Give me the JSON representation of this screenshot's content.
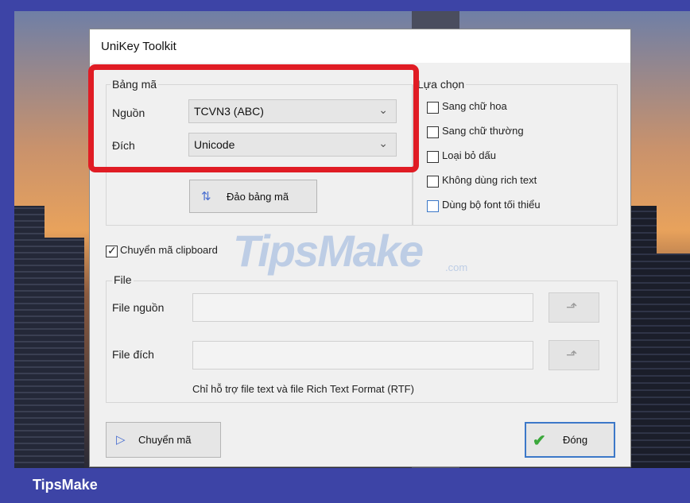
{
  "window": {
    "title": "UniKey Toolkit"
  },
  "charset": {
    "legend": "Bảng mã",
    "source_label": "Nguồn",
    "source_value": "TCVN3 (ABC)",
    "target_label": "Đích",
    "target_value": "Unicode",
    "swap_button": "Đảo bảng mã"
  },
  "options": {
    "legend": "Lựa chọn",
    "items": [
      {
        "label": "Sang chữ hoa",
        "checked": false
      },
      {
        "label": "Sang chữ thường",
        "checked": false
      },
      {
        "label": "Loại bỏ dấu",
        "checked": false
      },
      {
        "label": "Không dùng rich text",
        "checked": false
      },
      {
        "label": "Dùng bộ font tối thiểu",
        "checked": false
      }
    ]
  },
  "clipboard": {
    "label": "Chuyển mã clipboard",
    "checked": true
  },
  "file": {
    "legend": "File",
    "source_label": "File nguồn",
    "source_value": "",
    "target_label": "File đích",
    "target_value": "",
    "note": "Chỉ hỗ trợ file text và file Rich Text Format (RTF)"
  },
  "actions": {
    "convert": "Chuyển mã",
    "close": "Đóng"
  },
  "watermark": {
    "main": "TipsMake",
    "suffix": ".com"
  },
  "footer": {
    "brand": "TipsMake"
  },
  "colors": {
    "highlight": "#e01c24",
    "brand_bar": "#3d44a6",
    "accept": "#3ca83c"
  }
}
